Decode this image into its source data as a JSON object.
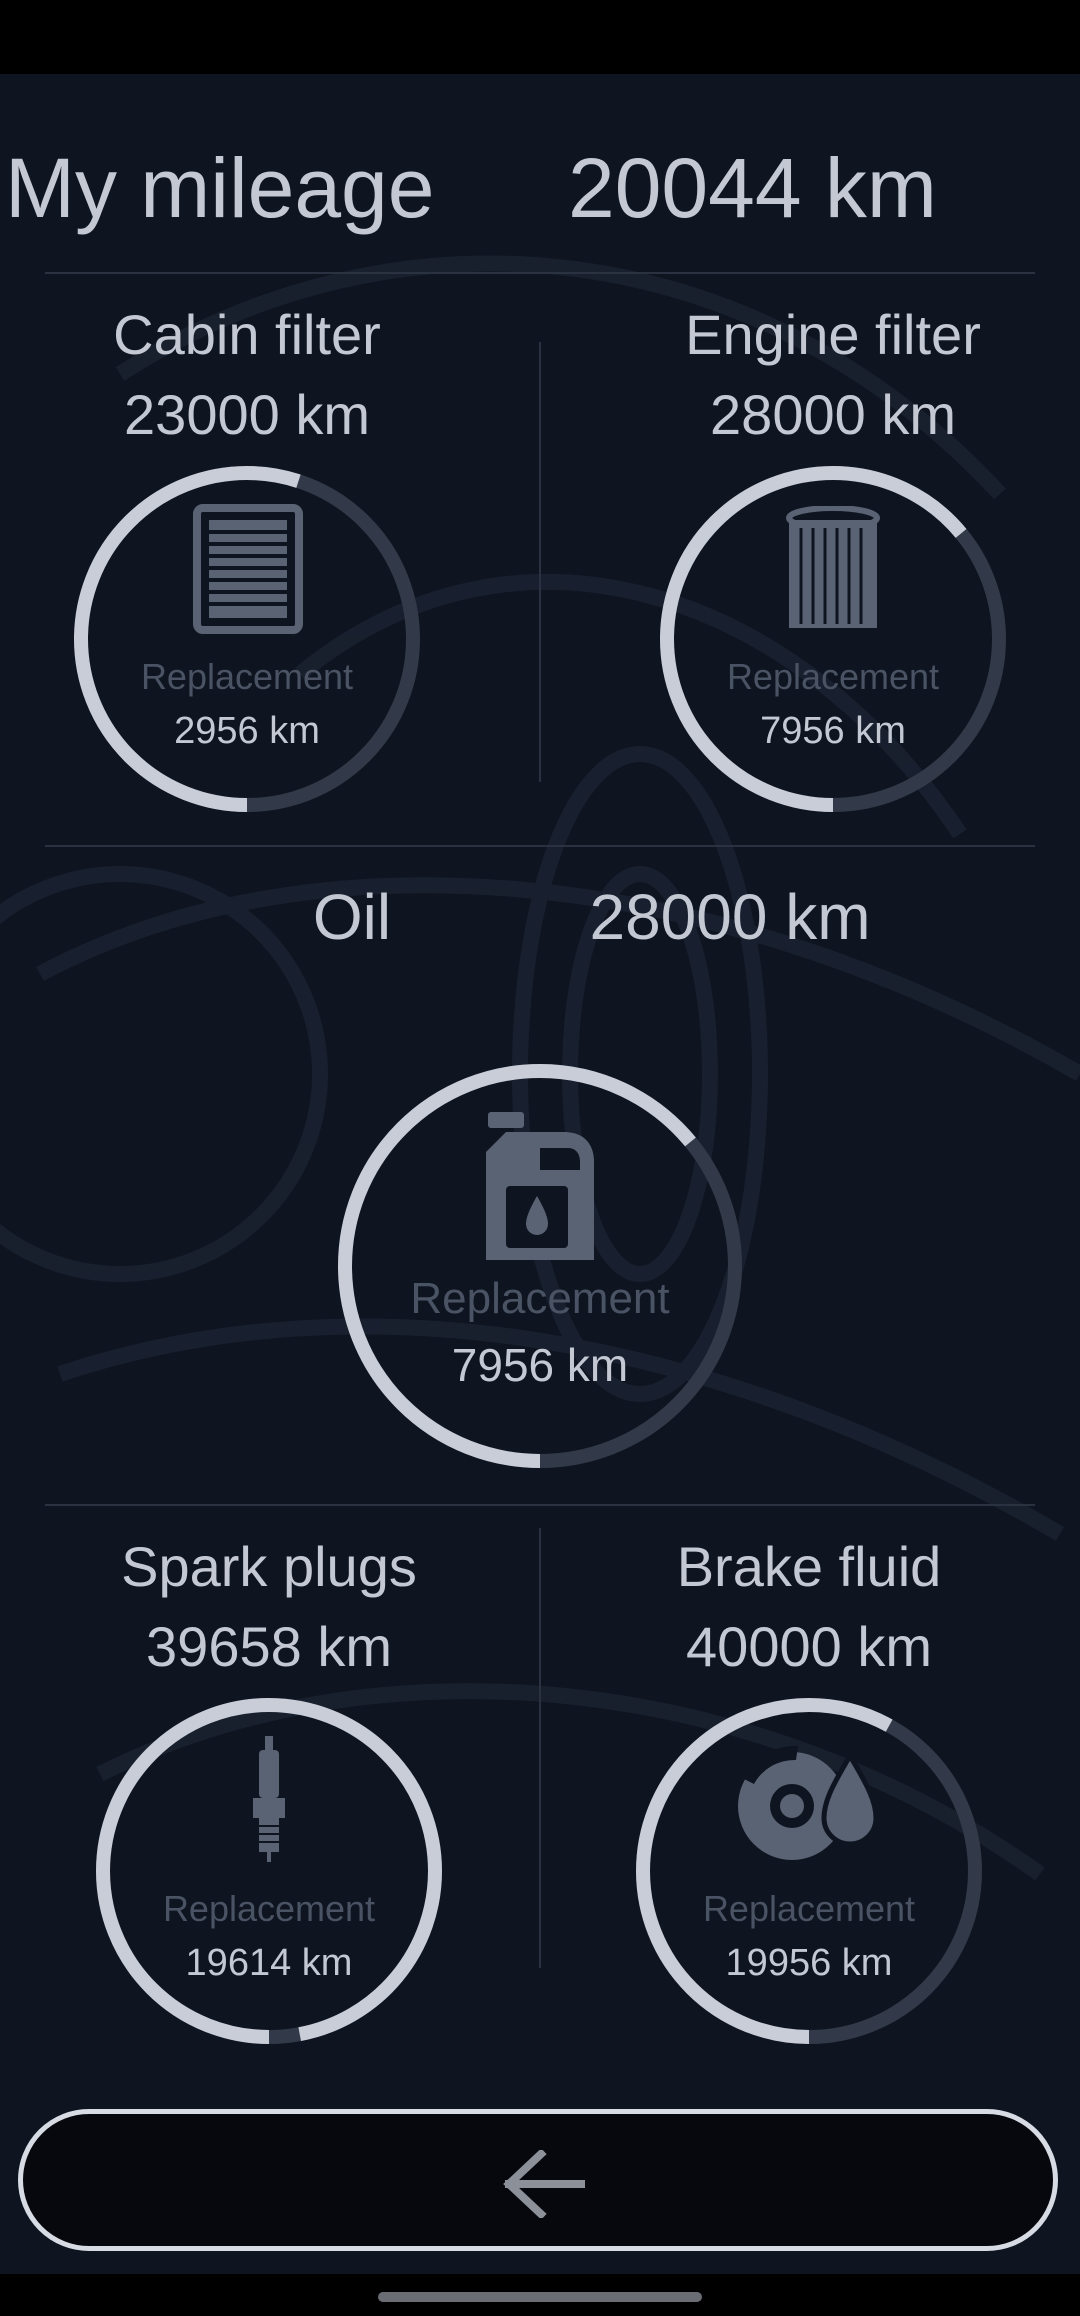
{
  "header": {
    "label": "My mileage",
    "value": "20044 km"
  },
  "replacement_label": "Replacement",
  "colors": {
    "ring": "#c9cdd8",
    "ring_track": "#323a49",
    "icon": "#5a6373",
    "background": "#0e1420"
  },
  "items": [
    {
      "id": "cabin-filter",
      "name": "Cabin filter",
      "interval": "23000 km",
      "remaining": "2956 km",
      "icon": "cabin-filter-icon",
      "ring_fraction": 0.55
    },
    {
      "id": "engine-filter",
      "name": "Engine filter",
      "interval": "28000 km",
      "remaining": "7956 km",
      "icon": "engine-filter-icon",
      "ring_fraction": 0.64
    },
    {
      "id": "oil",
      "name": "Oil",
      "interval": "28000 km",
      "remaining": "7956 km",
      "icon": "oil-canister-icon",
      "ring_fraction": 0.64
    },
    {
      "id": "spark-plugs",
      "name": "Spark plugs",
      "interval": "39658 km",
      "remaining": "19614 km",
      "icon": "spark-plug-icon",
      "ring_fraction": 0.97
    },
    {
      "id": "brake-fluid",
      "name": "Brake fluid",
      "interval": "40000 km",
      "remaining": "19956 km",
      "icon": "brake-fluid-icon",
      "ring_fraction": 0.58
    }
  ],
  "back_button": {
    "icon": "arrow-left-icon"
  }
}
